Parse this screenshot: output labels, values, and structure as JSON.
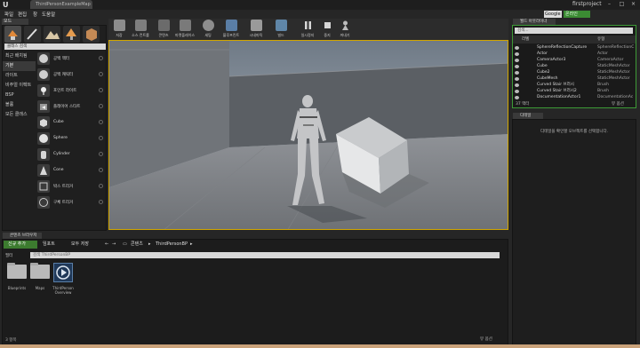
{
  "window": {
    "tab_title": "ThirdPersonExampleMap",
    "project_name": "firstproject"
  },
  "menu": {
    "items": [
      "파일",
      "편집",
      "창",
      "도움말"
    ]
  },
  "header": {
    "search_placeholder": "Google",
    "online_badge": "온라인"
  },
  "modes": {
    "tab_label": "모드",
    "search_placeholder": "클래스 검색",
    "categories": [
      {
        "label": "최근 배치됨",
        "active": false
      },
      {
        "label": "기본",
        "active": true
      },
      {
        "label": "라이트",
        "active": false
      },
      {
        "label": "비주얼 이펙트",
        "active": false
      },
      {
        "label": "BSP",
        "active": false
      },
      {
        "label": "볼륨",
        "active": false
      },
      {
        "label": "모든 클래스",
        "active": false
      }
    ],
    "placeables": [
      {
        "label": "공백 액터",
        "icon": "empty-actor-icon"
      },
      {
        "label": "공백 캐릭터",
        "icon": "empty-character-icon"
      },
      {
        "label": "포인트 라이트",
        "icon": "point-light-icon"
      },
      {
        "label": "플레이어 스타트",
        "icon": "player-start-icon"
      },
      {
        "label": "Cube",
        "icon": "cube-icon"
      },
      {
        "label": "Sphere",
        "icon": "sphere-icon"
      },
      {
        "label": "Cylinder",
        "icon": "cylinder-icon"
      },
      {
        "label": "Cone",
        "icon": "cone-icon"
      },
      {
        "label": "박스 트리거",
        "icon": "box-trigger-icon"
      },
      {
        "label": "구체 트리거",
        "icon": "sphere-trigger-icon"
      }
    ]
  },
  "toolbar": {
    "buttons": [
      {
        "label": "저장",
        "color": "#8c8c8c"
      },
      {
        "label": "소스 컨트롤",
        "color": "#7e7e7e"
      },
      {
        "label": "콘텐츠",
        "color": "#6b6b6b"
      },
      {
        "label": "마켓플레이스",
        "color": "#7a7a7a"
      },
      {
        "label": "세팅",
        "color": "#8d8d8d"
      },
      {
        "label": "블루프린트",
        "color": "#5a7ea6"
      },
      {
        "label": "시네마틱",
        "color": "#9a9a9a"
      },
      {
        "label": "빌드",
        "color": "#5f86a8"
      },
      {
        "label": "일시정지",
        "color": "#cfcfcf"
      },
      {
        "label": "중지",
        "color": "#cfcfcf"
      },
      {
        "label": "꺼내기",
        "color": "#a8a8a8"
      }
    ]
  },
  "content_browser": {
    "tab_label": "콘텐츠 브라우저",
    "add_new": "신규 추가",
    "import": "임포트",
    "save_all": "모두 저장",
    "breadcrumb_root": "콘텐츠",
    "breadcrumb_current": "ThirdPersonBP",
    "filters_label": "필터",
    "search_placeholder": "검색 ThirdPersonBP",
    "assets": [
      {
        "label": "Blueprints",
        "kind": "folder"
      },
      {
        "label": "Maps",
        "kind": "folder"
      },
      {
        "label": "ThirdPerson Overview",
        "kind": "asset"
      }
    ],
    "item_count": "3 항목",
    "view_options": "뷰 옵션"
  },
  "outliner": {
    "tab_label": "월드 아웃라이너",
    "search_placeholder": "검색...",
    "col_label": "라벨",
    "col_type": "유형",
    "rows": [
      {
        "name": "SphereReflectionCapture",
        "type": "SphereReflectionC"
      },
      {
        "name": "Actor",
        "type": "Actor"
      },
      {
        "name": "CameraActor3",
        "type": "CameraActor"
      },
      {
        "name": "Cube",
        "type": "StaticMeshActor"
      },
      {
        "name": "Cube2",
        "type": "StaticMeshActor"
      },
      {
        "name": "CubeMesh",
        "type": "StaticMeshActor"
      },
      {
        "name": "Curved Stair 브러시",
        "type": "Brush"
      },
      {
        "name": "Curved Stair 브러시2",
        "type": "Brush"
      },
      {
        "name": "DocumentationActor1",
        "type": "DocumentationAc"
      }
    ],
    "count": "37 액터",
    "view_options": "뷰 옵션"
  },
  "details": {
    "tab_label": "디테일",
    "empty_message": "디테일을 확인할 오브젝트를 선택합니다."
  },
  "colors": {
    "accent_green": "#3c7b2f",
    "viewport_border": "#d1a600",
    "outliner_border": "#3d9a36"
  }
}
